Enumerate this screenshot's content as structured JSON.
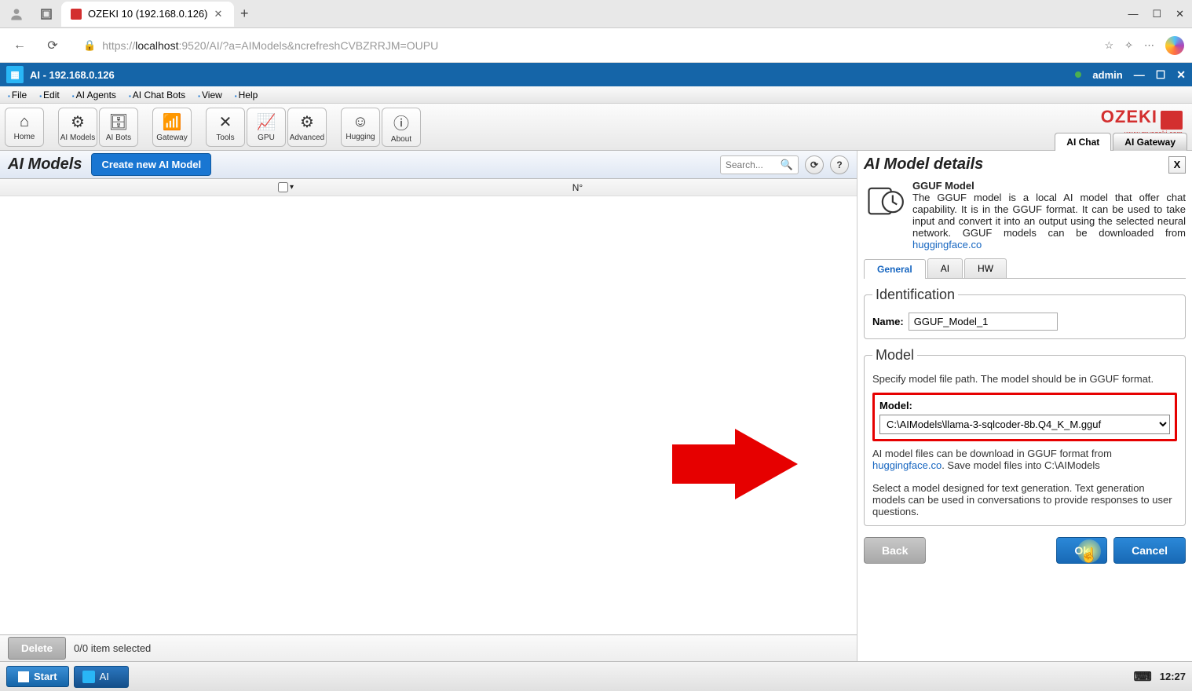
{
  "browser": {
    "tab_title": "OZEKI 10 (192.168.0.126)",
    "url_prefix": "https://",
    "url_host": "localhost",
    "url_rest": ":9520/AI/?a=AIModels&ncrefreshCVBZRRJM=OUPU"
  },
  "app": {
    "title": "AI - 192.168.0.126",
    "user": "admin"
  },
  "menu": [
    "File",
    "Edit",
    "AI Agents",
    "AI Chat Bots",
    "View",
    "Help"
  ],
  "toolbar": [
    {
      "label": "Home",
      "icon": "⌂"
    },
    {
      "label": "AI Models",
      "icon": "⚙"
    },
    {
      "label": "AI Bots",
      "icon": "🗄"
    },
    {
      "label": "Gateway",
      "icon": "📶"
    },
    {
      "label": "Tools",
      "icon": "✕"
    },
    {
      "label": "GPU",
      "icon": "📈"
    },
    {
      "label": "Advanced",
      "icon": "⚙"
    },
    {
      "label": "Hugging",
      "icon": "☺"
    },
    {
      "label": "About",
      "icon": "ⓘ"
    }
  ],
  "right_tabs": {
    "chat": "AI Chat",
    "gateway": "AI Gateway"
  },
  "logo": {
    "main": "OZEKI",
    "sub": "www.myozeki.com"
  },
  "main": {
    "title": "AI Models",
    "create_btn": "Create new AI Model",
    "search_placeholder": "Search...",
    "col_n": "N°"
  },
  "footer": {
    "delete": "Delete",
    "selection": "0/0 item selected"
  },
  "details": {
    "title": "AI Model details",
    "model_name_hdr": "GGUF Model",
    "desc": "The GGUF model is a local AI model that offer chat capability. It is in the GGUF format. It can be used to take input and convert it into an output using the selected neural network. GGUF models can be downloaded from ",
    "desc_link": "huggingface.co",
    "tabs": {
      "general": "General",
      "ai": "AI",
      "hw": "HW"
    },
    "ident_legend": "Identification",
    "name_label": "Name:",
    "name_value": "GGUF_Model_1",
    "model_legend": "Model",
    "model_help1": "Specify model file path. The model should be in GGUF format.",
    "model_label": "Model:",
    "model_value": "C:\\AIModels\\llama-3-sqlcoder-8b.Q4_K_M.gguf",
    "model_help2a": "AI model files can be download in GGUF format from ",
    "model_help2_link": "huggingface.co",
    "model_help2b": ". Save model files into C:\\AIModels",
    "model_help3": "Select a model designed for text generation. Text generation models can be used in conversations to provide responses to user questions.",
    "buttons": {
      "back": "Back",
      "ok": "Ok",
      "cancel": "Cancel"
    }
  },
  "taskbar": {
    "start": "Start",
    "task": "AI",
    "clock": "12:27"
  }
}
